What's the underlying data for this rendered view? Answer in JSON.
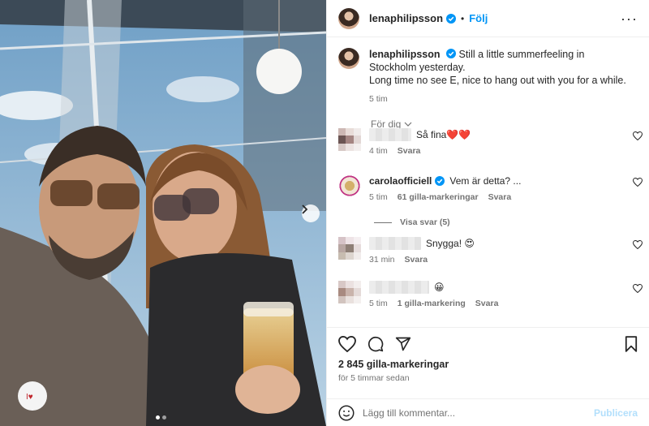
{
  "post": {
    "username": "lenaphilipsson",
    "follow_label": "Följ",
    "caption_line1": "Still a little summerfeeling in Stockholm yesterday.",
    "caption_line2": "Long time no see E, nice to hang out with you for a while.",
    "caption_time": "5 tim",
    "for_dig_label": "För dig"
  },
  "comments": [
    {
      "name": "",
      "text": "Så fina❤️❤️",
      "time": "4 tim",
      "likes": "",
      "reply": "Svara"
    },
    {
      "name": "carolaofficiell",
      "text": "Vem är detta? ...",
      "time": "5 tim",
      "likes": "61 gilla-markeringar",
      "reply": "Svara"
    },
    {
      "name": "",
      "text": "Snygga! 😍",
      "time": "31 min",
      "likes": "",
      "reply": "Svara"
    },
    {
      "name": "",
      "text": "😀",
      "time": "5 tim",
      "likes": "1 gilla-markering",
      "reply": "Svara"
    }
  ],
  "view_replies": "Visa svar (5)",
  "footer": {
    "likes": "2 845 gilla-markeringar",
    "time_ago": "för 5 timmar sedan",
    "comment_placeholder": "Lägg till kommentar...",
    "publish_label": "Publicera"
  },
  "icons": [
    "heart-icon",
    "comment-icon",
    "share-icon",
    "bookmark-icon",
    "emoji-icon",
    "more-icon",
    "verified-icon",
    "chevron-right-icon",
    "chevron-down-icon"
  ],
  "colors": {
    "accent": "#0095f6",
    "publish_disabled": "#b2dffc",
    "verified": "#0095f6",
    "muted": "#737373"
  }
}
